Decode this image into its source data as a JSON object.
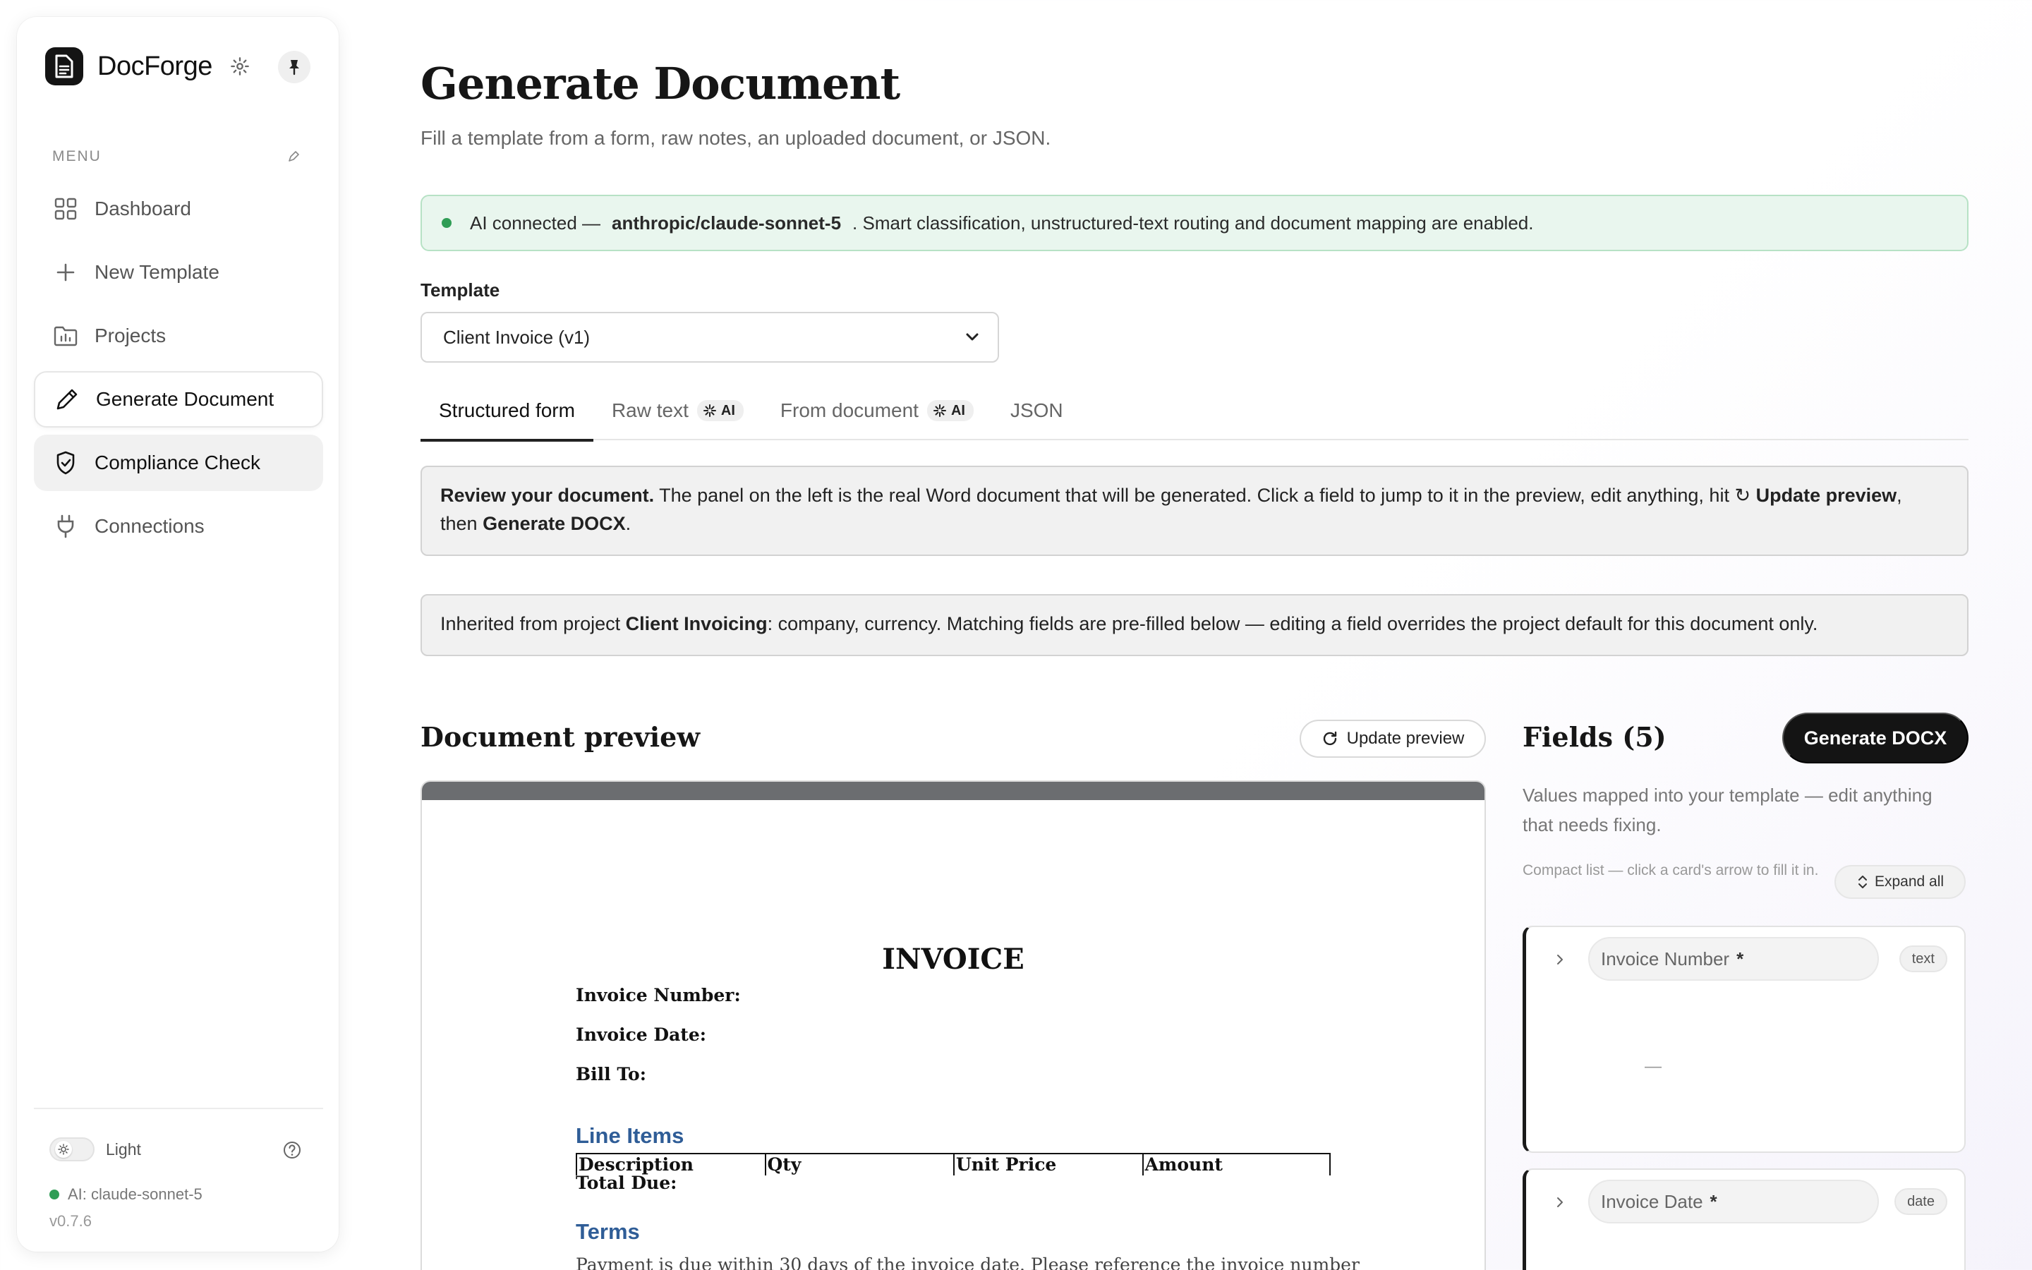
{
  "app": {
    "name": "DocForge",
    "menu_label": "MENU",
    "nav": [
      {
        "label": "Dashboard",
        "icon": "grid-icon"
      },
      {
        "label": "New Template",
        "icon": "plus-icon"
      },
      {
        "label": "Projects",
        "icon": "folder-icon"
      },
      {
        "label": "Generate Document",
        "icon": "pen-icon",
        "active": true
      },
      {
        "label": "Compliance Check",
        "icon": "shield-check-icon"
      },
      {
        "label": "Connections",
        "icon": "plug-icon"
      }
    ],
    "theme_label": "Light",
    "ai_status": "AI: claude-sonnet-5",
    "version": "v0.7.6"
  },
  "page": {
    "title": "Generate Document",
    "subtitle": "Fill a template from a form, raw notes, an uploaded document, or JSON."
  },
  "ai_banner": {
    "prefix": "AI connected —",
    "model": "anthropic/claude-sonnet-5",
    "suffix": ". Smart classification, unstructured-text routing and document mapping are enabled."
  },
  "template": {
    "label": "Template",
    "selected": "Client Invoice (v1)"
  },
  "tabs": [
    {
      "label": "Structured form",
      "active": true,
      "ai": false
    },
    {
      "label": "Raw text",
      "ai": true
    },
    {
      "label": "From document",
      "ai": true
    },
    {
      "label": "JSON",
      "ai": false
    }
  ],
  "ai_badge_label": "AI",
  "notice_review": {
    "b1": "Review your document.",
    "t1": " The panel on the left is the real Word document that will be generated. Click a field to jump to it in the preview, edit anything, hit ",
    "glyph": "↻ ",
    "b2": "Update preview",
    "t2": ",",
    "t3": "then ",
    "b3": "Generate DOCX",
    "t4": "."
  },
  "notice_inherit": {
    "t1": "Inherited from project ",
    "b1": "Client Invoicing",
    "t2": ": company, currency. Matching fields are pre-filled below — editing a field overrides the project default for this document only."
  },
  "preview": {
    "title": "Document preview",
    "update_label": "Update preview",
    "doc": {
      "title": "INVOICE",
      "fields": [
        "Invoice Number:",
        "Invoice Date:",
        "Bill To:"
      ],
      "line_items_heading": "Line Items",
      "table_headers": [
        "Description",
        "Qty",
        "Unit Price",
        "Amount"
      ],
      "total_label": "Total Due:",
      "terms_heading": "Terms",
      "terms_text": "Payment is due within 30 days of the invoice date. Please reference the invoice number"
    }
  },
  "fields_panel": {
    "title": "Fields (5)",
    "generate_label": "Generate DOCX",
    "description": "Values mapped into your template — edit anything that needs fixing.",
    "compact_hint": "Compact list — click a card's arrow to fill it in.",
    "expand_label": "Expand all",
    "fields": [
      {
        "name": "Invoice Number",
        "required": "*",
        "type": "text",
        "value": "—"
      },
      {
        "name": "Invoice Date",
        "required": "*",
        "type": "date"
      }
    ]
  },
  "colors": {
    "accent_dark": "#141414",
    "success": "#2f9d55",
    "banner_bg": "#e9f6ee",
    "doc_heading": "#2f5d97"
  }
}
